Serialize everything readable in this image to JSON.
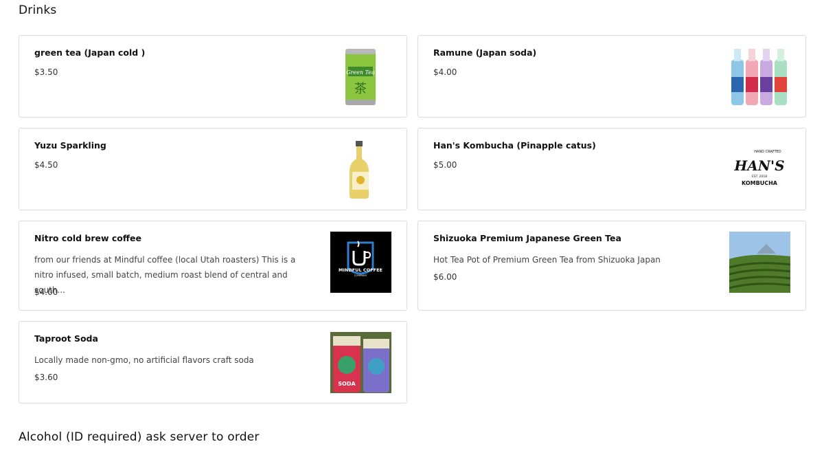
{
  "sections": [
    {
      "title": "Drinks",
      "items": [
        {
          "name": "green tea (Japan cold )",
          "description": "",
          "price": "$3.50",
          "image": "green-tea-can"
        },
        {
          "name": "Ramune (Japan soda)",
          "description": "",
          "price": "$4.00",
          "image": "ramune-bottles"
        },
        {
          "name": "Yuzu Sparkling",
          "description": "",
          "price": "$4.50",
          "image": "yuzu-bottle"
        },
        {
          "name": "Han's Kombucha (Pinapple catus)",
          "description": "",
          "price": "$5.00",
          "image": "hans-kombucha-logo"
        },
        {
          "name": "Nitro cold brew coffee",
          "description": "from our friends at Mindful coffee (local Utah roasters) This is a nitro infused, small batch, medium roast blend of central and south...",
          "price": "$4.00",
          "image": "mindful-coffee-logo"
        },
        {
          "name": "Shizuoka Premium Japanese Green Tea",
          "description": "Hot Tea Pot of Premium Green Tea from Shizuoka Japan",
          "price": "$6.00",
          "image": "tea-field-photo"
        },
        {
          "name": "Taproot Soda",
          "description": "Locally made non-gmo, no artificial flavors craft soda",
          "price": "$3.60",
          "image": "taproot-soda-cans"
        }
      ]
    },
    {
      "title": "Alcohol (ID required) ask server to order"
    }
  ],
  "image_text": {
    "green_tea_can": "Green Tea",
    "hans_logo_top": "HAND CRAFTED",
    "hans_logo_name": "HAN'S",
    "hans_logo_est": "EST. 2018",
    "hans_logo_bottom": "KOMBUCHA",
    "mindful_logo": "MINDFUL COFFEE",
    "mindful_logo_sub": "COMPANY",
    "taproot_label": "SODA"
  },
  "colors": {
    "card_border": "#dcdcdc",
    "text": "#111111",
    "muted": "#444444"
  }
}
